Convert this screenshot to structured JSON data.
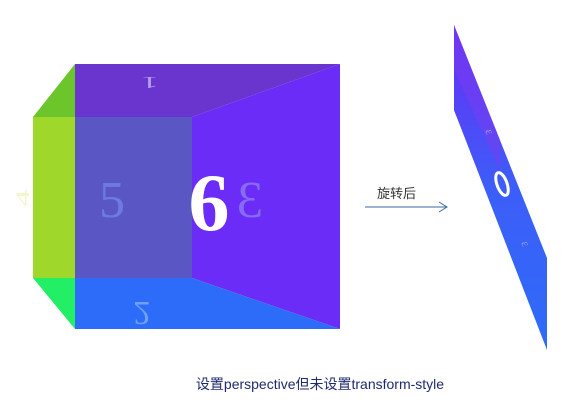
{
  "arrow_label": "旋转后",
  "caption": "设置perspective但未设置transform-style",
  "faces": {
    "front": "6",
    "back": "5",
    "left": "4",
    "right": "3",
    "top": "1",
    "bottom": "2"
  },
  "colors": {
    "top_face": "#6a34cf",
    "right_face": "#6a2cf6",
    "bottom_face": "#2d6cf8",
    "left_face": "#9fd82b",
    "back_face": "#5a57c5",
    "top_left_wedge": "#6cc52a",
    "bottom_left_wedge": "#22ee66",
    "arrow": "#3a6aa0"
  }
}
